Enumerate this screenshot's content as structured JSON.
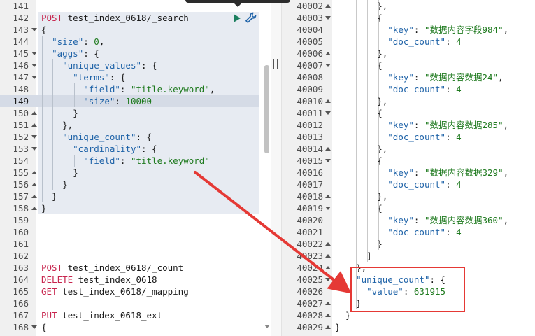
{
  "request_pane": {
    "lines": [
      {
        "n": "141"
      },
      {
        "n": "142",
        "tokens": [
          {
            "t": "POST",
            "c": "method"
          },
          {
            "t": " test_index_0618/_search",
            "c": "url"
          }
        ]
      },
      {
        "n": "143",
        "fold": "down",
        "tokens": [
          {
            "t": "{",
            "c": "pun"
          }
        ]
      },
      {
        "n": "144",
        "tokens": [
          {
            "t": "  ",
            "c": "pun"
          },
          {
            "t": "\"size\"",
            "c": "key"
          },
          {
            "t": ": ",
            "c": "pun"
          },
          {
            "t": "0",
            "c": "num"
          },
          {
            "t": ",",
            "c": "pun"
          }
        ]
      },
      {
        "n": "145",
        "fold": "down",
        "tokens": [
          {
            "t": "  ",
            "c": "pun"
          },
          {
            "t": "\"aggs\"",
            "c": "key"
          },
          {
            "t": ": {",
            "c": "pun"
          }
        ]
      },
      {
        "n": "146",
        "fold": "down",
        "tokens": [
          {
            "t": "    ",
            "c": "pun"
          },
          {
            "t": "\"unique_values\"",
            "c": "key"
          },
          {
            "t": ": {",
            "c": "pun"
          }
        ]
      },
      {
        "n": "147",
        "fold": "down",
        "tokens": [
          {
            "t": "      ",
            "c": "pun"
          },
          {
            "t": "\"terms\"",
            "c": "key"
          },
          {
            "t": ": {",
            "c": "pun"
          }
        ]
      },
      {
        "n": "148",
        "tokens": [
          {
            "t": "        ",
            "c": "pun"
          },
          {
            "t": "\"field\"",
            "c": "key"
          },
          {
            "t": ": ",
            "c": "pun"
          },
          {
            "t": "\"title.keyword\"",
            "c": "str"
          },
          {
            "t": ",",
            "c": "pun"
          }
        ]
      },
      {
        "n": "149",
        "active": true,
        "tokens": [
          {
            "t": "        ",
            "c": "pun"
          },
          {
            "t": "\"size\"",
            "c": "key"
          },
          {
            "t": ": ",
            "c": "pun"
          },
          {
            "t": "10000",
            "c": "num"
          }
        ]
      },
      {
        "n": "150",
        "fold": "up",
        "tokens": [
          {
            "t": "      }",
            "c": "pun"
          }
        ]
      },
      {
        "n": "151",
        "fold": "up",
        "tokens": [
          {
            "t": "    },",
            "c": "pun"
          }
        ]
      },
      {
        "n": "152",
        "fold": "down",
        "tokens": [
          {
            "t": "    ",
            "c": "pun"
          },
          {
            "t": "\"unique_count\"",
            "c": "key"
          },
          {
            "t": ": {",
            "c": "pun"
          }
        ]
      },
      {
        "n": "153",
        "fold": "down",
        "tokens": [
          {
            "t": "      ",
            "c": "pun"
          },
          {
            "t": "\"cardinality\"",
            "c": "key"
          },
          {
            "t": ": {",
            "c": "pun"
          }
        ]
      },
      {
        "n": "154",
        "tokens": [
          {
            "t": "        ",
            "c": "pun"
          },
          {
            "t": "\"field\"",
            "c": "key"
          },
          {
            "t": ": ",
            "c": "pun"
          },
          {
            "t": "\"title.keyword\"",
            "c": "str"
          }
        ]
      },
      {
        "n": "155",
        "fold": "up",
        "tokens": [
          {
            "t": "      }",
            "c": "pun"
          }
        ]
      },
      {
        "n": "156",
        "fold": "up",
        "tokens": [
          {
            "t": "    }",
            "c": "pun"
          }
        ]
      },
      {
        "n": "157",
        "fold": "up",
        "tokens": [
          {
            "t": "  }",
            "c": "pun"
          }
        ]
      },
      {
        "n": "158",
        "fold": "up",
        "tokens": [
          {
            "t": "}",
            "c": "pun"
          }
        ]
      },
      {
        "n": "159"
      },
      {
        "n": "160"
      },
      {
        "n": "161"
      },
      {
        "n": "162"
      },
      {
        "n": "163",
        "tokens": [
          {
            "t": "POST",
            "c": "method"
          },
          {
            "t": " test_index_0618/_count",
            "c": "url"
          }
        ]
      },
      {
        "n": "164",
        "tokens": [
          {
            "t": "DELETE",
            "c": "method"
          },
          {
            "t": " test_index_0618",
            "c": "url"
          }
        ]
      },
      {
        "n": "165",
        "tokens": [
          {
            "t": "GET",
            "c": "method"
          },
          {
            "t": " test_index_0618/_mapping",
            "c": "url"
          }
        ]
      },
      {
        "n": "166"
      },
      {
        "n": "167",
        "tokens": [
          {
            "t": "PUT",
            "c": "method"
          },
          {
            "t": " test_index_0618_ext",
            "c": "url"
          }
        ]
      },
      {
        "n": "168",
        "fold": "down",
        "tokens": [
          {
            "t": "{",
            "c": "pun"
          }
        ]
      }
    ]
  },
  "response_pane": {
    "lines": [
      {
        "n": "40002",
        "fold": "up",
        "tokens": [
          {
            "t": "        },",
            "c": "pun"
          }
        ]
      },
      {
        "n": "40003",
        "fold": "down",
        "tokens": [
          {
            "t": "        {",
            "c": "pun"
          }
        ]
      },
      {
        "n": "40004",
        "tokens": [
          {
            "t": "          ",
            "c": "pun"
          },
          {
            "t": "\"key\"",
            "c": "key"
          },
          {
            "t": ": ",
            "c": "pun"
          },
          {
            "t": "\"数据内容字段984\"",
            "c": "str"
          },
          {
            "t": ",",
            "c": "pun"
          }
        ]
      },
      {
        "n": "40005",
        "tokens": [
          {
            "t": "          ",
            "c": "pun"
          },
          {
            "t": "\"doc_count\"",
            "c": "key"
          },
          {
            "t": ": ",
            "c": "pun"
          },
          {
            "t": "4",
            "c": "num"
          }
        ]
      },
      {
        "n": "40006",
        "fold": "up",
        "tokens": [
          {
            "t": "        },",
            "c": "pun"
          }
        ]
      },
      {
        "n": "40007",
        "fold": "down",
        "tokens": [
          {
            "t": "        {",
            "c": "pun"
          }
        ]
      },
      {
        "n": "40008",
        "tokens": [
          {
            "t": "          ",
            "c": "pun"
          },
          {
            "t": "\"key\"",
            "c": "key"
          },
          {
            "t": ": ",
            "c": "pun"
          },
          {
            "t": "\"数据内容数据24\"",
            "c": "str"
          },
          {
            "t": ",",
            "c": "pun"
          }
        ]
      },
      {
        "n": "40009",
        "tokens": [
          {
            "t": "          ",
            "c": "pun"
          },
          {
            "t": "\"doc_count\"",
            "c": "key"
          },
          {
            "t": ": ",
            "c": "pun"
          },
          {
            "t": "4",
            "c": "num"
          }
        ]
      },
      {
        "n": "40010",
        "fold": "up",
        "tokens": [
          {
            "t": "        },",
            "c": "pun"
          }
        ]
      },
      {
        "n": "40011",
        "fold": "down",
        "tokens": [
          {
            "t": "        {",
            "c": "pun"
          }
        ]
      },
      {
        "n": "40012",
        "tokens": [
          {
            "t": "          ",
            "c": "pun"
          },
          {
            "t": "\"key\"",
            "c": "key"
          },
          {
            "t": ": ",
            "c": "pun"
          },
          {
            "t": "\"数据内容数据285\"",
            "c": "str"
          },
          {
            "t": ",",
            "c": "pun"
          }
        ]
      },
      {
        "n": "40013",
        "tokens": [
          {
            "t": "          ",
            "c": "pun"
          },
          {
            "t": "\"doc_count\"",
            "c": "key"
          },
          {
            "t": ": ",
            "c": "pun"
          },
          {
            "t": "4",
            "c": "num"
          }
        ]
      },
      {
        "n": "40014",
        "fold": "up",
        "tokens": [
          {
            "t": "        },",
            "c": "pun"
          }
        ]
      },
      {
        "n": "40015",
        "fold": "down",
        "tokens": [
          {
            "t": "        {",
            "c": "pun"
          }
        ]
      },
      {
        "n": "40016",
        "tokens": [
          {
            "t": "          ",
            "c": "pun"
          },
          {
            "t": "\"key\"",
            "c": "key"
          },
          {
            "t": ": ",
            "c": "pun"
          },
          {
            "t": "\"数据内容数据329\"",
            "c": "str"
          },
          {
            "t": ",",
            "c": "pun"
          }
        ]
      },
      {
        "n": "40017",
        "tokens": [
          {
            "t": "          ",
            "c": "pun"
          },
          {
            "t": "\"doc_count\"",
            "c": "key"
          },
          {
            "t": ": ",
            "c": "pun"
          },
          {
            "t": "4",
            "c": "num"
          }
        ]
      },
      {
        "n": "40018",
        "fold": "up",
        "tokens": [
          {
            "t": "        },",
            "c": "pun"
          }
        ]
      },
      {
        "n": "40019",
        "fold": "down",
        "tokens": [
          {
            "t": "        {",
            "c": "pun"
          }
        ]
      },
      {
        "n": "40020",
        "tokens": [
          {
            "t": "          ",
            "c": "pun"
          },
          {
            "t": "\"key\"",
            "c": "key"
          },
          {
            "t": ": ",
            "c": "pun"
          },
          {
            "t": "\"数据内容数据360\"",
            "c": "str"
          },
          {
            "t": ",",
            "c": "pun"
          }
        ]
      },
      {
        "n": "40021",
        "tokens": [
          {
            "t": "          ",
            "c": "pun"
          },
          {
            "t": "\"doc_count\"",
            "c": "key"
          },
          {
            "t": ": ",
            "c": "pun"
          },
          {
            "t": "4",
            "c": "num"
          }
        ]
      },
      {
        "n": "40022",
        "fold": "up",
        "tokens": [
          {
            "t": "        }",
            "c": "pun"
          }
        ]
      },
      {
        "n": "40023",
        "fold": "up",
        "tokens": [
          {
            "t": "      ]",
            "c": "pun"
          }
        ]
      },
      {
        "n": "40024",
        "fold": "up",
        "tokens": [
          {
            "t": "    },",
            "c": "pun"
          }
        ]
      },
      {
        "n": "40025",
        "fold": "down",
        "tokens": [
          {
            "t": "    ",
            "c": "pun"
          },
          {
            "t": "\"unique_count\"",
            "c": "key"
          },
          {
            "t": ": {",
            "c": "pun"
          }
        ]
      },
      {
        "n": "40026",
        "tokens": [
          {
            "t": "      ",
            "c": "pun"
          },
          {
            "t": "\"value\"",
            "c": "key"
          },
          {
            "t": ": ",
            "c": "pun"
          },
          {
            "t": "631915",
            "c": "num"
          }
        ]
      },
      {
        "n": "40027",
        "fold": "up",
        "tokens": [
          {
            "t": "    }",
            "c": "pun"
          }
        ]
      },
      {
        "n": "40028",
        "fold": "up",
        "tokens": [
          {
            "t": "  }",
            "c": "pun"
          }
        ]
      },
      {
        "n": "40029",
        "fold": "up",
        "tokens": [
          {
            "t": "}",
            "c": "pun"
          }
        ]
      }
    ]
  },
  "toolbar": {
    "run_icon": "play-icon",
    "settings_icon": "wrench-icon"
  },
  "annotation": {
    "box_color": "#e53935",
    "arrow_color": "#e53935"
  }
}
